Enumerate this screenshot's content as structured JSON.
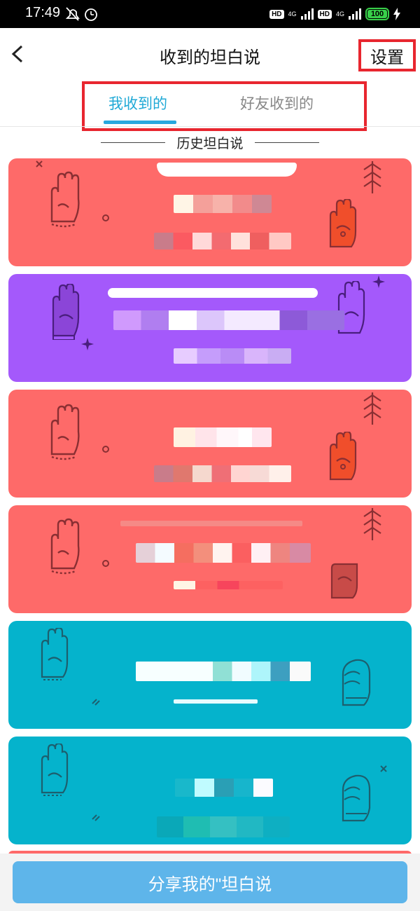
{
  "status_bar": {
    "time": "17:49",
    "network1": "4G",
    "network2": "4G",
    "hd": "HD",
    "battery": "100",
    "battery_level": 1.0
  },
  "header": {
    "title": "收到的坦白说",
    "settings_label": "设置"
  },
  "tabs": [
    {
      "label": "我收到的",
      "active": true
    },
    {
      "label": "好友收到的",
      "active": false
    }
  ],
  "section_title": "历史坦白说",
  "cards": [
    {
      "color": "#fe6a69",
      "icon_left": "bracelet-hand-icon",
      "icon_right": "fist-icon"
    },
    {
      "color": "#a459fb",
      "icon_left": "hand-icon",
      "icon_right": "hand-icon"
    },
    {
      "color": "#fe6a69",
      "icon_left": "bracelet-hand-icon",
      "icon_right": "fist-icon"
    },
    {
      "color": "#fe6a69",
      "icon_left": "bracelet-hand-icon",
      "icon_right": "fist-icon"
    },
    {
      "color": "#05b3cc",
      "icon_left": "hand-icon",
      "icon_right": "fist-icon"
    },
    {
      "color": "#05b3cc",
      "icon_left": "hand-icon",
      "icon_right": "fist-icon"
    }
  ],
  "share_button": "分享我的\"坦白说"
}
